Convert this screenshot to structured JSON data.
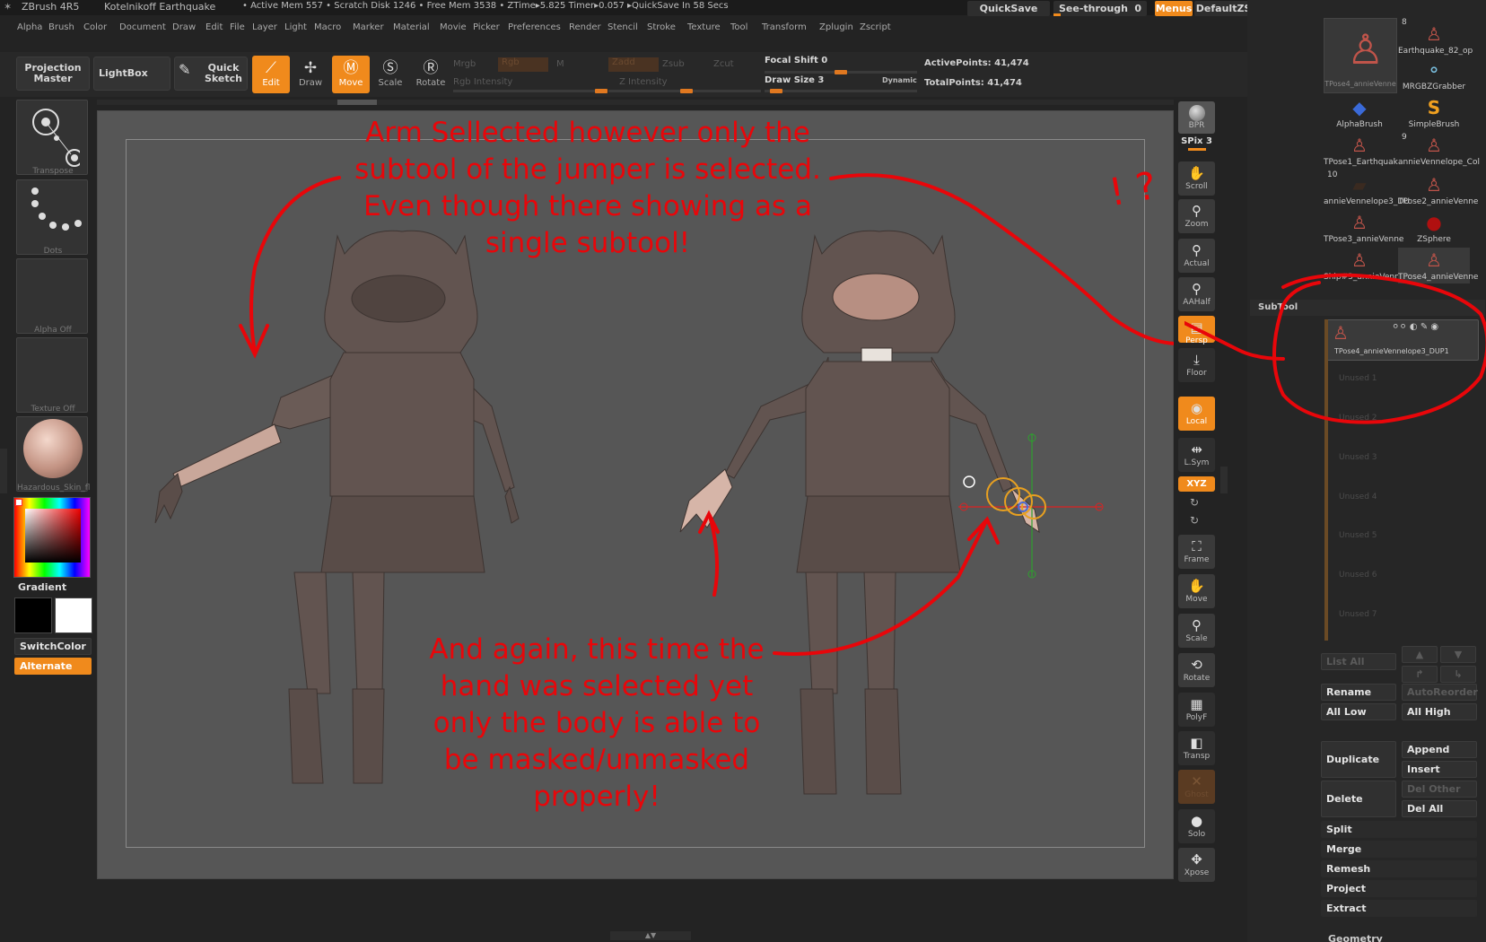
{
  "titlebar": {
    "app": "ZBrush 4R5",
    "project": "Kotelnikoff Earthquake",
    "status": "• Active Mem 557 • Scratch Disk 1246 • Free Mem 3538 • ZTime▸5.825 Timer▸0.057 ▸QuickSave In 58 Secs",
    "quicksave": "QuickSave",
    "seethrough": "See-through",
    "seethrough_val": "0",
    "menus": "Menus",
    "script": "DefaultZScript"
  },
  "menu": [
    "Alpha",
    "Brush",
    "Color",
    "Document",
    "Draw",
    "Edit",
    "File",
    "Layer",
    "Light",
    "Macro",
    "Marker",
    "Material",
    "Movie",
    "Picker",
    "Preferences",
    "Render",
    "Stencil",
    "Stroke",
    "Texture",
    "Tool",
    "Transform",
    "Zplugin",
    "Zscript"
  ],
  "toolbar": {
    "projection_master": "Projection Master",
    "lightbox": "LightBox",
    "quick_sketch": "Quick Sketch",
    "edit": "Edit",
    "draw": "Draw",
    "move": "Move",
    "scale": "Scale",
    "rotate": "Rotate",
    "mrgb": "Mrgb",
    "rgb": "Rgb",
    "m": "M",
    "rgb_intensity": "Rgb Intensity",
    "zadd": "Zadd",
    "zsub": "Zsub",
    "zcut": "Zcut",
    "z_intensity": "Z Intensity",
    "focal_shift": "Focal Shift",
    "focal_shift_val": "0",
    "draw_size": "Draw Size",
    "draw_size_val": "3",
    "dynamic": "Dynamic",
    "active_points": "ActivePoints: 41,474",
    "total_points": "TotalPoints: 41,474"
  },
  "left_shelf": {
    "transpose": "Transpose",
    "dots": "Dots",
    "alpha": "Alpha Off",
    "texture": "Texture Off",
    "material": "Hazardous_Skin_fl",
    "gradient": "Gradient",
    "switchcolor": "SwitchColor",
    "alternate": "Alternate"
  },
  "annotations": {
    "top": "Arm Sellected however only the subtool of the jumper is selected. Even though there showing as a single subtool!",
    "bottom": "And again, this time the hand was selected yet only the body is able to be masked/unmasked properly!",
    "exclaim": "! ?"
  },
  "right_toolbar": [
    "BPR",
    "SPix 3",
    "Scroll",
    "Zoom",
    "Actual",
    "AAHalf",
    "Persp",
    "Floor",
    "Local",
    "L.Sym",
    "XYZ",
    "Frame",
    "Move",
    "Scale",
    "Rotate",
    "PolyF",
    "Transp",
    "Ghost",
    "Solo",
    "Xpose"
  ],
  "tool_palette": [
    {
      "label": "TPose4_annieVenne",
      "icon": "figure-red",
      "count": ""
    },
    {
      "label": "Earthquake_82_op",
      "icon": "figure-red",
      "count": "8"
    },
    {
      "label": "MRGBZGrabber",
      "icon": "spheres",
      "count": ""
    },
    {
      "label": "AlphaBrush",
      "icon": "blue-brush",
      "count": ""
    },
    {
      "label": "SimpleBrush",
      "icon": "s-brush",
      "count": ""
    },
    {
      "label": "TPose1_Earthquak",
      "icon": "figure-red",
      "count": "9"
    },
    {
      "label": "annieVennelope_Col",
      "icon": "figure-red",
      "count": ""
    },
    {
      "label": "annieVennelope3_DU",
      "icon": "figure-dark",
      "count": "10"
    },
    {
      "label": "TPose2_annieVenne",
      "icon": "figure-red",
      "count": ""
    },
    {
      "label": "TPose3_annieVenne",
      "icon": "figure-red",
      "count": ""
    },
    {
      "label": "ZSphere",
      "icon": "sphere-red",
      "count": ""
    },
    {
      "label": "Ship#3_annieVenne",
      "icon": "figure-red",
      "count": ""
    },
    {
      "label": "TPose4_annieVenne",
      "icon": "figure-red",
      "count": ""
    }
  ],
  "subtool": {
    "header": "SubTool",
    "active_item": "TPose4_annieVennelope3_DUP1",
    "unused": [
      "Unused 1",
      "Unused 2",
      "Unused 3",
      "Unused 4",
      "Unused 5",
      "Unused 6",
      "Unused 7"
    ],
    "list_all": "List All",
    "rename": "Rename",
    "auto_reorder": "AutoReorder",
    "all_low": "All Low",
    "all_high": "All High",
    "duplicate": "Duplicate",
    "append": "Append",
    "insert": "Insert",
    "delete": "Delete",
    "del_other": "Del Other",
    "del_all": "Del All",
    "split": "Split",
    "merge": "Merge",
    "remesh": "Remesh",
    "project": "Project",
    "extract": "Extract",
    "geometry": "Geometry"
  },
  "colors": {
    "accent": "#f08a1c",
    "annotation": "#e8060a",
    "canvas": "#565656"
  }
}
